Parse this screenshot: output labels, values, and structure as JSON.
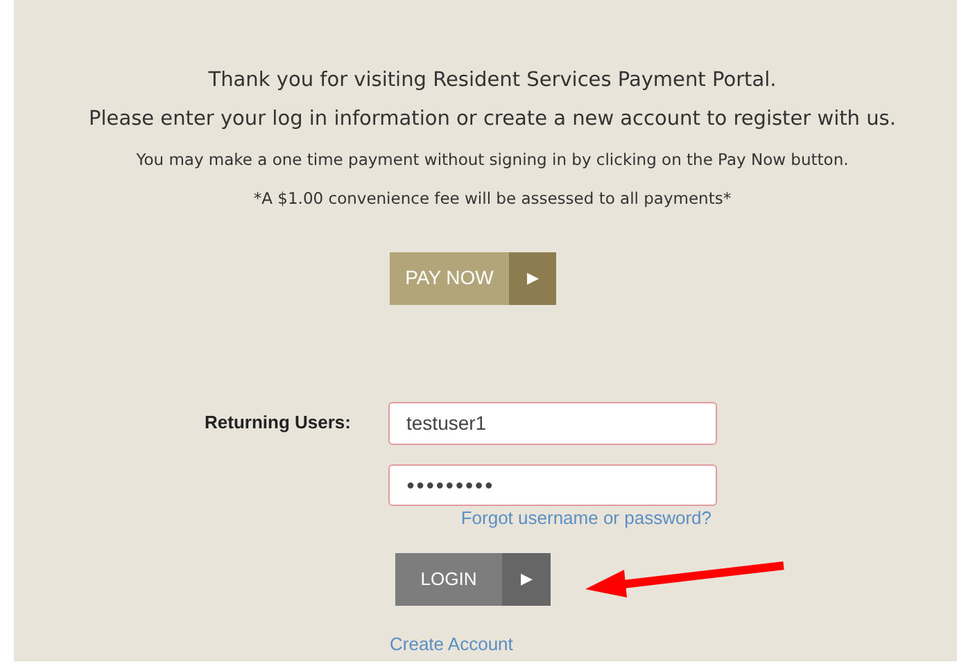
{
  "intro": {
    "heading": "Thank you for visiting Resident Services Payment Portal.",
    "subheading": "Please enter your log in information or create a new account to register with us.",
    "note": "You may make a one time payment without signing in by clicking on the Pay Now button.",
    "fee_note": "*A $1.00 convenience fee will be assessed to all payments*"
  },
  "pay_now_button": {
    "label": "PAY NOW",
    "arrow": "▶"
  },
  "login": {
    "label": "Returning Users:",
    "username": {
      "value": "testuser1"
    },
    "password": {
      "value": "●●●●●●●●●"
    },
    "forgot_link": "Forgot username or password?",
    "login_button": {
      "label": "LOGIN",
      "arrow": "▶"
    },
    "create_account_link": "Create Account"
  }
}
